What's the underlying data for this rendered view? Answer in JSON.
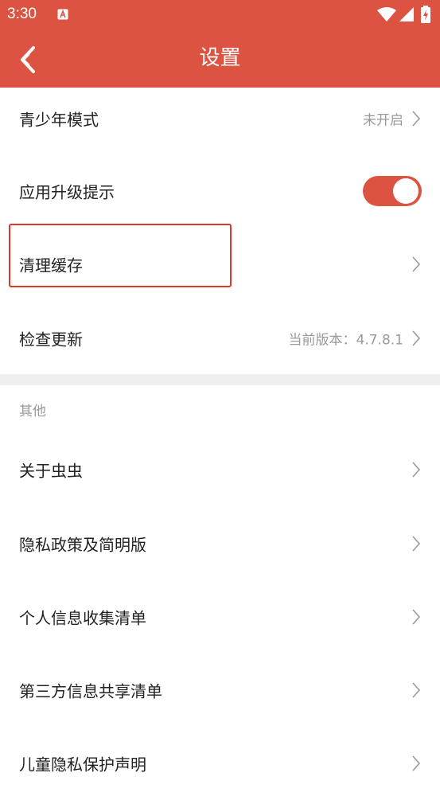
{
  "status_bar": {
    "time": "3:30"
  },
  "header": {
    "title": "设置"
  },
  "settings": [
    {
      "label": "青少年模式",
      "value": "未开启"
    },
    {
      "label": "应用升级提示",
      "toggle_on": true
    },
    {
      "label": "清理缓存"
    },
    {
      "label": "检查更新",
      "value": "当前版本：4.7.8.1"
    }
  ],
  "other_section": {
    "title": "其他",
    "items": [
      {
        "label": "关于虫虫"
      },
      {
        "label": "隐私政策及简明版"
      },
      {
        "label": "个人信息收集清单"
      },
      {
        "label": "第三方信息共享清单"
      },
      {
        "label": "儿童隐私保护声明"
      }
    ]
  },
  "colors": {
    "accent": "#dd5342",
    "highlight_border": "#d93a2c",
    "muted_text": "#9a9a9a"
  }
}
